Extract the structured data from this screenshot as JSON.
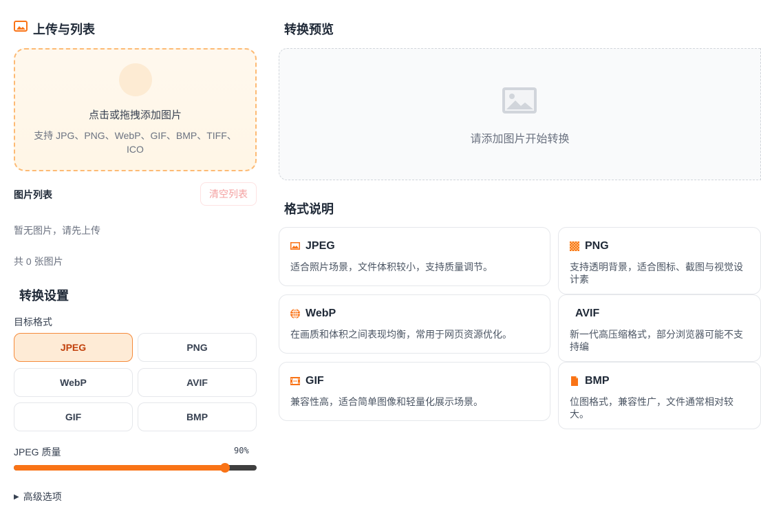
{
  "upload": {
    "title": "上传与列表",
    "drop_title": "点击或拖拽添加图片",
    "drop_sub": "支持 JPG、PNG、WebP、GIF、BMP、TIFF、ICO"
  },
  "list": {
    "title": "图片列表",
    "clear": "清空列表",
    "empty": "暂无图片，请先上传",
    "count": "共 0 张图片"
  },
  "settings": {
    "title": "转换设置",
    "target_label": "目标格式",
    "formats": [
      "JPEG",
      "PNG",
      "WebP",
      "AVIF",
      "GIF",
      "BMP"
    ],
    "selected": "JPEG",
    "quality_label": "JPEG 质量",
    "quality_value": "90%",
    "quality": 90,
    "advanced": "高级选项"
  },
  "preview": {
    "title": "转换预览",
    "empty": "请添加图片开始转换"
  },
  "info": {
    "title": "格式说明",
    "cards": [
      {
        "name": "JPEG",
        "desc": "适合照片场景，文件体积较小，支持质量调节。",
        "icon": "image-icon"
      },
      {
        "name": "PNG",
        "desc": "支持透明背景，适合图标、截图与视觉设计素",
        "icon": "checker-icon"
      },
      {
        "name": "WebP",
        "desc": "在画质和体积之间表现均衡，常用于网页资源优化。",
        "icon": "globe-icon"
      },
      {
        "name": "AVIF",
        "desc": "新一代高压缩格式，部分浏览器可能不支持编",
        "icon": ""
      },
      {
        "name": "GIF",
        "desc": "兼容性高，适合简单图像和轻量化展示场景。",
        "icon": "film-icon"
      },
      {
        "name": "BMP",
        "desc": "位图格式，兼容性广，文件通常相对较大。",
        "icon": "file-icon"
      }
    ]
  },
  "colors": {
    "accent": "#f97316"
  }
}
